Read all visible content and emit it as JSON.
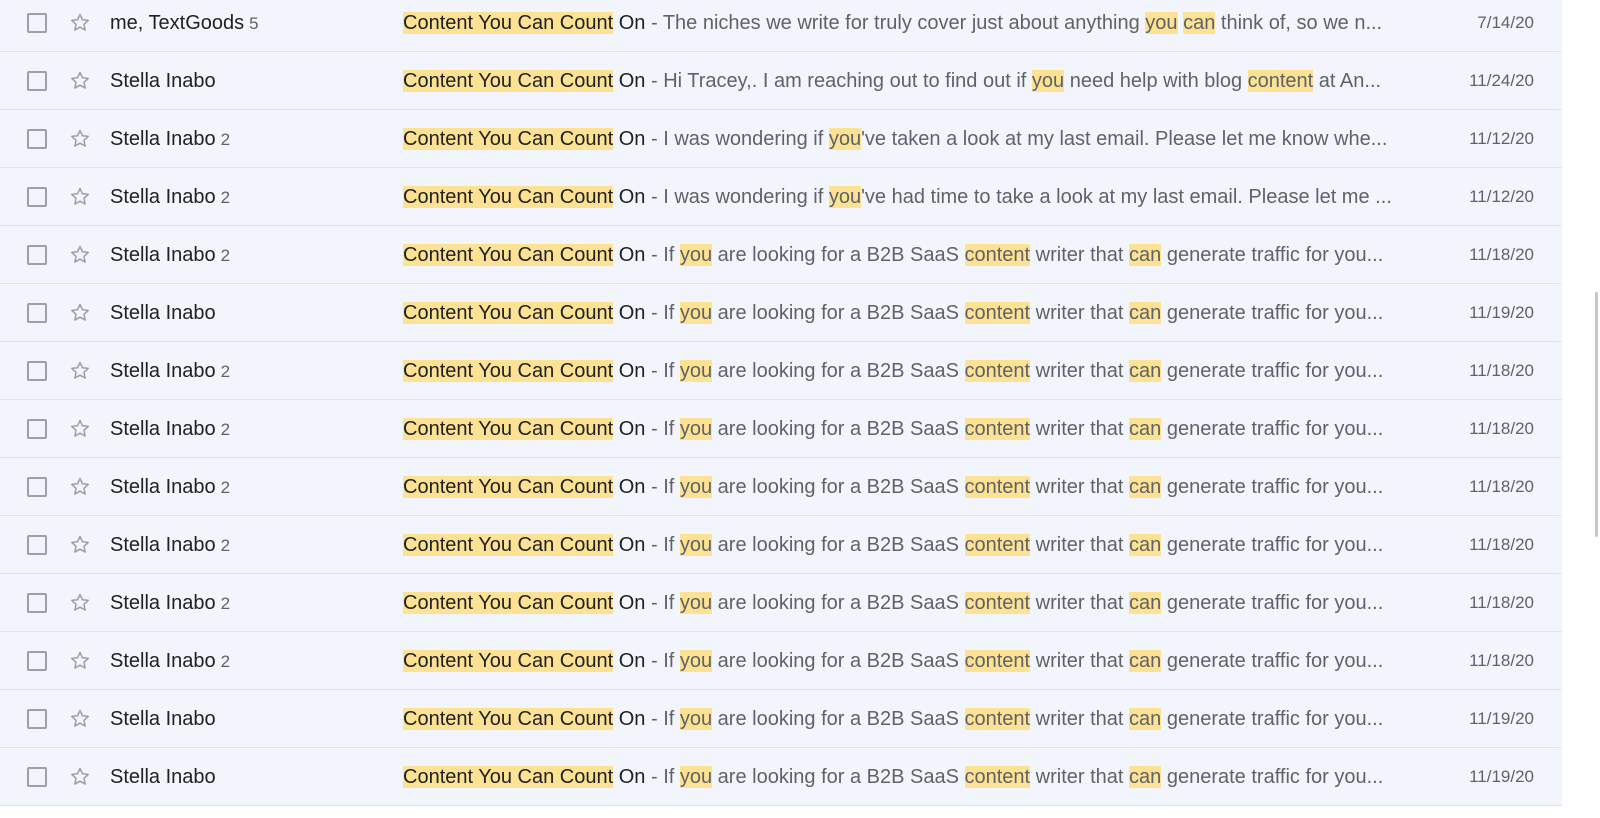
{
  "icons": {
    "checkbox": "checkbox-icon",
    "star": "star-outline-icon"
  },
  "colors": {
    "row_bg": "#f2f6fc",
    "highlight": "#fde293",
    "text_dark": "#202124",
    "text_muted": "#5f6368"
  },
  "emails": [
    {
      "sender": "me, TextGoods",
      "count": "5",
      "date": "7/14/20",
      "subject_parts": [
        {
          "text": "Content You Can Count",
          "hl": true
        },
        {
          "text": " On",
          "hl": false
        }
      ],
      "separator": " - ",
      "snippet_parts": [
        {
          "text": "The niches we write for truly cover just about anything ",
          "hl": false
        },
        {
          "text": "you",
          "hl": true
        },
        {
          "text": " ",
          "hl": false
        },
        {
          "text": "can",
          "hl": true
        },
        {
          "text": " think of, so we n...",
          "hl": false
        }
      ]
    },
    {
      "sender": "Stella Inabo",
      "count": "",
      "date": "11/24/20",
      "subject_parts": [
        {
          "text": "Content You Can Count",
          "hl": true
        },
        {
          "text": " On",
          "hl": false
        }
      ],
      "separator": " - ",
      "snippet_parts": [
        {
          "text": "Hi Tracey,. I am reaching out to find out if ",
          "hl": false
        },
        {
          "text": "you",
          "hl": true
        },
        {
          "text": " need help with blog ",
          "hl": false
        },
        {
          "text": "content",
          "hl": true
        },
        {
          "text": " at An...",
          "hl": false
        }
      ]
    },
    {
      "sender": "Stella Inabo",
      "count": "2",
      "date": "11/12/20",
      "subject_parts": [
        {
          "text": "Content You Can Count",
          "hl": true
        },
        {
          "text": " On",
          "hl": false
        }
      ],
      "separator": " - ",
      "snippet_parts": [
        {
          "text": "I was wondering if ",
          "hl": false
        },
        {
          "text": "you",
          "hl": true
        },
        {
          "text": "'ve taken a look at my last email. Please let me know whe...",
          "hl": false
        }
      ]
    },
    {
      "sender": "Stella Inabo",
      "count": "2",
      "date": "11/12/20",
      "subject_parts": [
        {
          "text": "Content You Can Count",
          "hl": true
        },
        {
          "text": " On",
          "hl": false
        }
      ],
      "separator": " - ",
      "snippet_parts": [
        {
          "text": "I was wondering if ",
          "hl": false
        },
        {
          "text": "you",
          "hl": true
        },
        {
          "text": "'ve had time to take a look at my last email. Please let me ...",
          "hl": false
        }
      ]
    },
    {
      "sender": "Stella Inabo",
      "count": "2",
      "date": "11/18/20",
      "subject_parts": [
        {
          "text": "Content You Can Count",
          "hl": true
        },
        {
          "text": " On",
          "hl": false
        }
      ],
      "separator": " - ",
      "snippet_parts": [
        {
          "text": "If ",
          "hl": false
        },
        {
          "text": "you",
          "hl": true
        },
        {
          "text": " are looking for a B2B SaaS ",
          "hl": false
        },
        {
          "text": "content",
          "hl": true
        },
        {
          "text": " writer that ",
          "hl": false
        },
        {
          "text": "can",
          "hl": true
        },
        {
          "text": " generate traffic for you...",
          "hl": false
        }
      ]
    },
    {
      "sender": "Stella Inabo",
      "count": "",
      "date": "11/19/20",
      "subject_parts": [
        {
          "text": "Content You Can Count",
          "hl": true
        },
        {
          "text": " On",
          "hl": false
        }
      ],
      "separator": " - ",
      "snippet_parts": [
        {
          "text": "If ",
          "hl": false
        },
        {
          "text": "you",
          "hl": true
        },
        {
          "text": " are looking for a B2B SaaS ",
          "hl": false
        },
        {
          "text": "content",
          "hl": true
        },
        {
          "text": " writer that ",
          "hl": false
        },
        {
          "text": "can",
          "hl": true
        },
        {
          "text": " generate traffic for you...",
          "hl": false
        }
      ]
    },
    {
      "sender": "Stella Inabo",
      "count": "2",
      "date": "11/18/20",
      "subject_parts": [
        {
          "text": "Content You Can Count",
          "hl": true
        },
        {
          "text": " On",
          "hl": false
        }
      ],
      "separator": " - ",
      "snippet_parts": [
        {
          "text": "If ",
          "hl": false
        },
        {
          "text": "you",
          "hl": true
        },
        {
          "text": " are looking for a B2B SaaS ",
          "hl": false
        },
        {
          "text": "content",
          "hl": true
        },
        {
          "text": " writer that ",
          "hl": false
        },
        {
          "text": "can",
          "hl": true
        },
        {
          "text": " generate traffic for you...",
          "hl": false
        }
      ]
    },
    {
      "sender": "Stella Inabo",
      "count": "2",
      "date": "11/18/20",
      "subject_parts": [
        {
          "text": "Content You Can Count",
          "hl": true
        },
        {
          "text": " On",
          "hl": false
        }
      ],
      "separator": " - ",
      "snippet_parts": [
        {
          "text": "If ",
          "hl": false
        },
        {
          "text": "you",
          "hl": true
        },
        {
          "text": " are looking for a B2B SaaS ",
          "hl": false
        },
        {
          "text": "content",
          "hl": true
        },
        {
          "text": " writer that ",
          "hl": false
        },
        {
          "text": "can",
          "hl": true
        },
        {
          "text": " generate traffic for you...",
          "hl": false
        }
      ]
    },
    {
      "sender": "Stella Inabo",
      "count": "2",
      "date": "11/18/20",
      "subject_parts": [
        {
          "text": "Content You Can Count",
          "hl": true
        },
        {
          "text": " On",
          "hl": false
        }
      ],
      "separator": " - ",
      "snippet_parts": [
        {
          "text": "If ",
          "hl": false
        },
        {
          "text": "you",
          "hl": true
        },
        {
          "text": " are looking for a B2B SaaS ",
          "hl": false
        },
        {
          "text": "content",
          "hl": true
        },
        {
          "text": " writer that ",
          "hl": false
        },
        {
          "text": "can",
          "hl": true
        },
        {
          "text": " generate traffic for you...",
          "hl": false
        }
      ]
    },
    {
      "sender": "Stella Inabo",
      "count": "2",
      "date": "11/18/20",
      "subject_parts": [
        {
          "text": "Content You Can Count",
          "hl": true
        },
        {
          "text": " On",
          "hl": false
        }
      ],
      "separator": " - ",
      "snippet_parts": [
        {
          "text": "If ",
          "hl": false
        },
        {
          "text": "you",
          "hl": true
        },
        {
          "text": " are looking for a B2B SaaS ",
          "hl": false
        },
        {
          "text": "content",
          "hl": true
        },
        {
          "text": " writer that ",
          "hl": false
        },
        {
          "text": "can",
          "hl": true
        },
        {
          "text": " generate traffic for you...",
          "hl": false
        }
      ]
    },
    {
      "sender": "Stella Inabo",
      "count": "2",
      "date": "11/18/20",
      "subject_parts": [
        {
          "text": "Content You Can Count",
          "hl": true
        },
        {
          "text": " On",
          "hl": false
        }
      ],
      "separator": " - ",
      "snippet_parts": [
        {
          "text": "If ",
          "hl": false
        },
        {
          "text": "you",
          "hl": true
        },
        {
          "text": " are looking for a B2B SaaS ",
          "hl": false
        },
        {
          "text": "content",
          "hl": true
        },
        {
          "text": " writer that ",
          "hl": false
        },
        {
          "text": "can",
          "hl": true
        },
        {
          "text": " generate traffic for you...",
          "hl": false
        }
      ]
    },
    {
      "sender": "Stella Inabo",
      "count": "2",
      "date": "11/18/20",
      "subject_parts": [
        {
          "text": "Content You Can Count",
          "hl": true
        },
        {
          "text": " On",
          "hl": false
        }
      ],
      "separator": " - ",
      "snippet_parts": [
        {
          "text": "If ",
          "hl": false
        },
        {
          "text": "you",
          "hl": true
        },
        {
          "text": " are looking for a B2B SaaS ",
          "hl": false
        },
        {
          "text": "content",
          "hl": true
        },
        {
          "text": " writer that ",
          "hl": false
        },
        {
          "text": "can",
          "hl": true
        },
        {
          "text": " generate traffic for you...",
          "hl": false
        }
      ]
    },
    {
      "sender": "Stella Inabo",
      "count": "",
      "date": "11/19/20",
      "subject_parts": [
        {
          "text": "Content You Can Count",
          "hl": true
        },
        {
          "text": " On",
          "hl": false
        }
      ],
      "separator": " - ",
      "snippet_parts": [
        {
          "text": "If ",
          "hl": false
        },
        {
          "text": "you",
          "hl": true
        },
        {
          "text": " are looking for a B2B SaaS ",
          "hl": false
        },
        {
          "text": "content",
          "hl": true
        },
        {
          "text": " writer that ",
          "hl": false
        },
        {
          "text": "can",
          "hl": true
        },
        {
          "text": " generate traffic for you...",
          "hl": false
        }
      ]
    },
    {
      "sender": "Stella Inabo",
      "count": "",
      "date": "11/19/20",
      "subject_parts": [
        {
          "text": "Content You Can Count",
          "hl": true
        },
        {
          "text": " On",
          "hl": false
        }
      ],
      "separator": " - ",
      "snippet_parts": [
        {
          "text": "If ",
          "hl": false
        },
        {
          "text": "you",
          "hl": true
        },
        {
          "text": " are looking for a B2B SaaS ",
          "hl": false
        },
        {
          "text": "content",
          "hl": true
        },
        {
          "text": " writer that ",
          "hl": false
        },
        {
          "text": "can",
          "hl": true
        },
        {
          "text": " generate traffic for you...",
          "hl": false
        }
      ]
    }
  ]
}
